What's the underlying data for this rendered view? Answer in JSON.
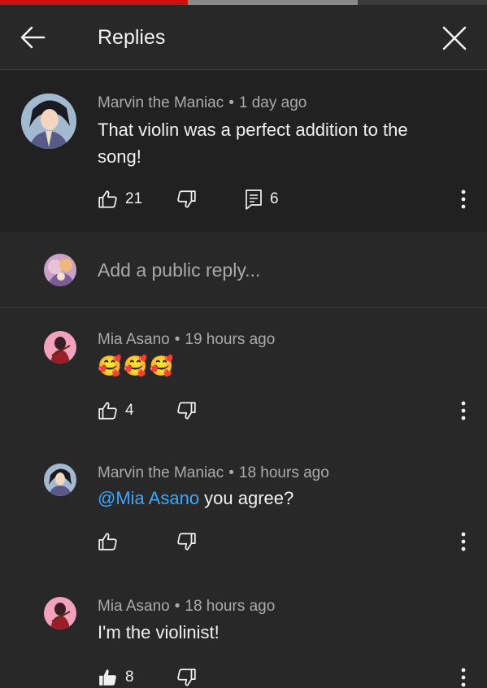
{
  "player": {
    "progress_played": 0.385,
    "progress_buffered_end": 0.735
  },
  "header": {
    "title": "Replies",
    "back_icon": "arrow-left-icon",
    "close_icon": "close-icon"
  },
  "parent_comment": {
    "author": "Marvin the Maniac",
    "separator": "•",
    "time": "1 day ago",
    "text": "That violin was a perfect addition to the song!",
    "likes": "21",
    "replies": "6"
  },
  "reply_box": {
    "placeholder": "Add a public reply..."
  },
  "replies": [
    {
      "author": "Mia Asano",
      "separator": "•",
      "time": "19 hours ago",
      "emoji": [
        "🥰",
        "🥰",
        "🥰"
      ],
      "likes": "4"
    },
    {
      "author": "Marvin the Maniac",
      "separator": "•",
      "time": "18 hours ago",
      "mention": "@Mia Asano",
      "text": " you agree?"
    },
    {
      "author": "Mia Asano",
      "separator": "•",
      "time": "18 hours ago",
      "text": "I'm the violinist!",
      "likes": "8",
      "liked": true
    }
  ],
  "colors": {
    "background": "#282828",
    "parent_background": "#212121",
    "mention": "#3ea6ff",
    "progress": "#cc1111"
  }
}
